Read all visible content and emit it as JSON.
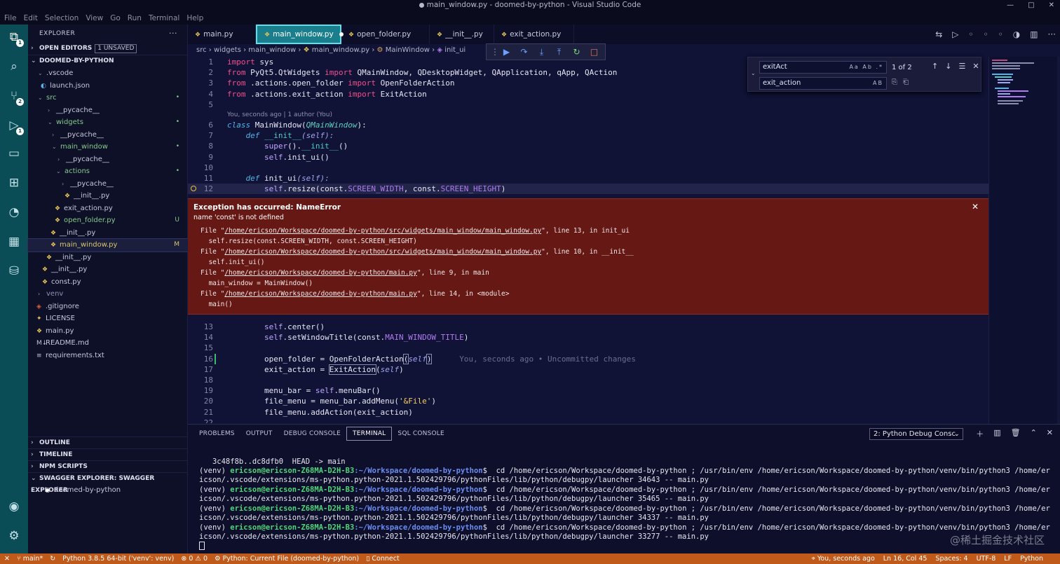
{
  "window": {
    "title": "main_window.py - doomed-by-python - Visual Studio Code"
  },
  "menu": [
    "File",
    "Edit",
    "Selection",
    "View",
    "Go",
    "Run",
    "Terminal",
    "Help"
  ],
  "activity_badges": {
    "explorer": "1",
    "scm": "2",
    "debug": "1"
  },
  "explorer": {
    "title": "EXPLORER",
    "open_editors": "OPEN EDITORS",
    "unsaved": "1 UNSAVED",
    "project": "DOOMED-BY-PYTHON",
    "tree": [
      {
        "label": ".vscode",
        "status": ""
      },
      {
        "label": "launch.json",
        "status": ""
      },
      {
        "label": "src",
        "status": "•"
      },
      {
        "label": "__pycache__",
        "status": ""
      },
      {
        "label": "widgets",
        "status": "•"
      },
      {
        "label": "__pycache__",
        "status": ""
      },
      {
        "label": "main_window",
        "status": "•"
      },
      {
        "label": "__pycache__",
        "status": ""
      },
      {
        "label": "actions",
        "status": "•"
      },
      {
        "label": "__pycache__",
        "status": ""
      },
      {
        "label": "__init__.py",
        "status": ""
      },
      {
        "label": "exit_action.py",
        "status": ""
      },
      {
        "label": "open_folder.py",
        "status": "U"
      },
      {
        "label": "__init__.py",
        "status": ""
      },
      {
        "label": "main_window.py",
        "status": "M"
      },
      {
        "label": "__init__.py",
        "status": ""
      },
      {
        "label": "__init__.py",
        "status": ""
      },
      {
        "label": "const.py",
        "status": ""
      },
      {
        "label": "venv",
        "status": ""
      },
      {
        "label": ".gitignore",
        "status": ""
      },
      {
        "label": "LICENSE",
        "status": ""
      },
      {
        "label": "main.py",
        "status": ""
      },
      {
        "label": "README.md",
        "status": ""
      },
      {
        "label": "requirements.txt",
        "status": ""
      }
    ],
    "outline": "OUTLINE",
    "timeline": "TIMELINE",
    "npm": "NPM SCRIPTS",
    "swagger": "SWAGGER EXPLORER: SWAGGER EXPLORER",
    "swagger_item": "doomed-by-python"
  },
  "tabs": [
    {
      "label": "main.py"
    },
    {
      "label": "main_window.py"
    },
    {
      "label": "open_folder.py"
    },
    {
      "label": "__init__.py"
    },
    {
      "label": "exit_action.py"
    }
  ],
  "breadcrumb": [
    "src",
    "widgets",
    "main_window",
    "main_window.py",
    "MainWindow",
    "init_ui"
  ],
  "find": {
    "search": "exitAct",
    "replace": "exit_action",
    "count": "1 of 2",
    "opts": "Aa Ab .*",
    "preserve": "AB"
  },
  "code": {
    "l1": {
      "num": "1",
      "a": "import",
      "b": " sys"
    },
    "l2": {
      "num": "2",
      "a": "from",
      "b": " PyQt5.QtWidgets ",
      "c": "import",
      "d": " QMainWindow, QDesktopWidget, QApplication, qApp, QAction"
    },
    "l3": {
      "num": "3",
      "a": "from",
      "b": " .actions.open_folder ",
      "c": "import",
      "d": " OpenFolderAction"
    },
    "l4": {
      "num": "4",
      "a": "from",
      "b": " .actions.exit_action ",
      "c": "import",
      "d": " ExitAction"
    },
    "l5": {
      "num": "5"
    },
    "lens": "You, seconds ago | 1 author (You)",
    "l6": {
      "num": "6",
      "a": "class",
      "b": " MainWindow(",
      "c": "QMainWindow",
      "d": "):"
    },
    "l7": {
      "num": "7",
      "a": "def",
      "b": " __init__",
      "c": "(self):"
    },
    "l8": {
      "num": "8",
      "a": "super",
      "b": "().",
      "c": "__init__",
      "d": "()"
    },
    "l9": {
      "num": "9",
      "a": "self",
      "b": ".init_ui()"
    },
    "l10": {
      "num": "10"
    },
    "l11": {
      "num": "11",
      "a": "def",
      "b": " init_ui",
      "c": "(self):"
    },
    "l12": {
      "num": "12",
      "a": "self",
      "b": ".resize(const.",
      "c": "SCREEN_WIDTH",
      "d": ", const.",
      "e": "SCREEN_HEIGHT",
      "f": ")"
    },
    "l13": {
      "num": "13",
      "a": "self",
      "b": ".center()"
    },
    "l14": {
      "num": "14",
      "a": "self",
      "b": ".setWindowTitle(const.",
      "c": "MAIN_WINDOW_TITLE",
      "d": ")"
    },
    "l15": {
      "num": "15"
    },
    "l16": {
      "num": "16",
      "a": "open_folder",
      "b": " = ",
      "c": "OpenFolderAction",
      "d": "(",
      "e": "self",
      "f": ")",
      "blame": "You, seconds ago • Uncommitted changes"
    },
    "l17": {
      "num": "17",
      "a": "exit_action",
      "b": " = ",
      "c": "ExitAction",
      "d": "(",
      "e": "self",
      "f": ")"
    },
    "l18": {
      "num": "18"
    },
    "l19": {
      "num": "19",
      "a": "menu_bar",
      "b": " = ",
      "c": "self",
      "d": ".menuBar()"
    },
    "l20": {
      "num": "20",
      "a": "file_menu",
      "b": " = menu_bar.addMenu(",
      "c": "'&File'",
      "d": ")"
    },
    "l21": {
      "num": "21",
      "a": "file_menu.addAction(exit_action)"
    },
    "l22": {
      "num": "22"
    }
  },
  "exception": {
    "title": "Exception has occurred: NameError",
    "message": "name 'const' is not defined",
    "tb": [
      {
        "pre": "File \"",
        "path": "/home/ericson/Workspace/doomed-by-python/src/widgets/main_window/main_window.py",
        "post": "\", line 13, in init_ui"
      },
      {
        "code": "  self.resize(const.SCREEN_WIDTH, const.SCREEN_HEIGHT)"
      },
      {
        "pre": "File \"",
        "path": "/home/ericson/Workspace/doomed-by-python/src/widgets/main_window/main_window.py",
        "post": "\", line 10, in __init__"
      },
      {
        "code": "  self.init_ui()"
      },
      {
        "pre": "File \"",
        "path": "/home/ericson/Workspace/doomed-by-python/main.py",
        "post": "\", line 9, in main"
      },
      {
        "code": "  main_window = MainWindow()"
      },
      {
        "pre": "File \"",
        "path": "/home/ericson/Workspace/doomed-by-python/main.py",
        "post": "\", line 14, in <module>"
      },
      {
        "code": "  main()"
      }
    ]
  },
  "panel": {
    "tabs": [
      "PROBLEMS",
      "OUTPUT",
      "DEBUG CONSOLE",
      "TERMINAL",
      "SQL CONSOLE"
    ],
    "select": "2: Python Debug Consc",
    "terminal": {
      "head": "   3c48f8b..dc8dfb0  HEAD -> main",
      "venv": "(venv) ",
      "user": "ericson@ericson-Z68MA-D2H-B3",
      "path": ":~/Workspace/doomed-by-python",
      "cmd1a": "$  cd /home/ericson/Workspace/doomed-by-python ; /usr/bin/env /home/ericson/Workspace/doomed-by-python/venv/bin/python3 /home/er",
      "cmd1b": "icson/.vscode/extensions/ms-python.python-2021.1.502429796/pythonFiles/lib/python/debugpy/launcher 34643 -- main.py",
      "cmd2b": "icson/.vscode/extensions/ms-python.python-2021.1.502429796/pythonFiles/lib/python/debugpy/launcher 35465 -- main.py",
      "cmd3b": "icson/.vscode/extensions/ms-python.python-2021.1.502429796/pythonFiles/lib/python/debugpy/launcher 34337 -- main.py",
      "cmd4b": "icson/.vscode/extensions/ms-python.python-2021.1.502429796/pythonFiles/lib/python/debugpy/launcher 33277 -- main.py"
    },
    "watermark": "@稀土掘金技术社区"
  },
  "status": {
    "branch": "main*",
    "python": "Python 3.8.5 64-bit ('venv': venv)",
    "errors": "0",
    "warnings": "0",
    "debug": "Python: Current File (doomed-by-python)",
    "connect": "Connect",
    "blame": "You, seconds ago",
    "position": "Ln 16, Col 45",
    "spaces": "Spaces: 4",
    "encoding": "UTF-8",
    "eol": "LF",
    "language": "Python"
  }
}
